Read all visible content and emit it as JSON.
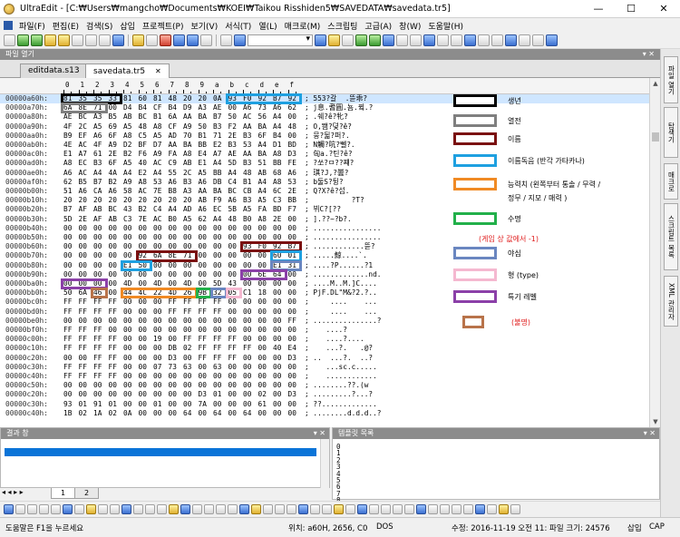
{
  "window": {
    "title": "UltraEdit - [C:₩Users₩mangcho₩Documents₩KOEI₩Taikou Risshiden5₩SAVEDATA₩savedata.tr5]",
    "minimize": "—",
    "maximize": "☐",
    "close": "✕"
  },
  "menu": [
    "파일(F)",
    "편집(E)",
    "검색(S)",
    "삽입",
    "프로젝트(P)",
    "보기(V)",
    "서식(T)",
    "열(L)",
    "매크로(M)",
    "스크립팅",
    "고급(A)",
    "창(W)",
    "도움말(H)"
  ],
  "file_panel": {
    "title": "파일 열기",
    "pin": "▾ ✕"
  },
  "tabs": [
    {
      "label": "editdata.s13",
      "active": false
    },
    {
      "label": "savedata.tr5",
      "active": true,
      "close": "✕"
    }
  ],
  "ruler": [
    "0",
    "1",
    "2",
    "3",
    "4",
    "5",
    "6",
    "7",
    "8",
    "9",
    "a",
    "b",
    "c",
    "d",
    "e",
    "f"
  ],
  "hex_rows": [
    {
      "addr": "00000a60h:",
      "bytes": [
        "81",
        "35",
        "35",
        "33",
        "81",
        "60",
        "81",
        "48",
        "20",
        "20",
        "0A",
        "93",
        "F0",
        "92",
        "B7",
        "92"
      ],
      "ascii": "; 553?갈  .뜯乖?",
      "current": true
    },
    {
      "addr": "00000a70h:",
      "bytes": [
        "6A",
        "8E",
        "71",
        "00",
        "D4",
        "B4",
        "CF",
        "B4",
        "D9",
        "A3",
        "AE",
        "00",
        "A6",
        "73",
        "A6",
        "62"
      ],
      "ascii": "; j息.耆圓.뇸.뀤.?"
    },
    {
      "addr": "00000a80h:",
      "bytes": [
        "AE",
        "BC",
        "A3",
        "B5",
        "AB",
        "BC",
        "B1",
        "6A",
        "AA",
        "BA",
        "B7",
        "50",
        "AC",
        "56",
        "A4",
        "00"
      ],
      "ascii": "; .쉐?ê?牝?"
    },
    {
      "addr": "00000a90h:",
      "bytes": [
        "4F",
        "2C",
        "A5",
        "69",
        "A5",
        "48",
        "A8",
        "CF",
        "A9",
        "50",
        "B3",
        "F2",
        "AA",
        "BA",
        "A4",
        "48"
      ],
      "ascii": "; O,뙘?뎢?ê?"
    },
    {
      "addr": "00000aa0h:",
      "bytes": [
        "B9",
        "EF",
        "A6",
        "6F",
        "A8",
        "C5",
        "A5",
        "AD",
        "70",
        "B1",
        "71",
        "2E",
        "B3",
        "6F",
        "B4",
        "00"
      ],
      "ascii": "; 뭉?뒮?퍼?."
    },
    {
      "addr": "00000ab0h:",
      "bytes": [
        "4E",
        "AC",
        "4F",
        "A9",
        "D2",
        "BF",
        "D7",
        "AA",
        "BA",
        "BB",
        "E2",
        "B3",
        "53",
        "A4",
        "D1",
        "BD"
      ],
      "ascii": "; N觸?吭?뻴?."
    },
    {
      "addr": "00000ac0h:",
      "bytes": [
        "E1",
        "A7",
        "61",
        "2E",
        "B2",
        "F6",
        "A9",
        "FA",
        "A8",
        "E4",
        "A7",
        "AE",
        "AA",
        "BA",
        "A8",
        "D3"
      ],
      "ascii": "; 匈a.?틴?ê?"
    },
    {
      "addr": "00000ad0h:",
      "bytes": [
        "A8",
        "EC",
        "B3",
        "6F",
        "A5",
        "40",
        "AC",
        "C9",
        "AB",
        "E1",
        "A4",
        "5D",
        "B3",
        "51",
        "BB",
        "FE"
      ],
      "ascii": "; ?쏘?ㅁ??쨰?"
    },
    {
      "addr": "00000ae0h:",
      "bytes": [
        "A6",
        "AC",
        "A4",
        "4A",
        "A4",
        "E2",
        "A4",
        "55",
        "2C",
        "A5",
        "BB",
        "A4",
        "48",
        "AB",
        "68",
        "A6"
      ],
      "ascii": "; 琪?J,?曇?"
    },
    {
      "addr": "00000af0h:",
      "bytes": [
        "62",
        "B5",
        "B7",
        "B2",
        "A9",
        "A8",
        "53",
        "A6",
        "B3",
        "A6",
        "DB",
        "C4",
        "B1",
        "A4",
        "A8",
        "53"
      ],
      "ascii": "; b둘S?뒹?"
    },
    {
      "addr": "00000b00h:",
      "bytes": [
        "51",
        "A6",
        "CA",
        "A6",
        "58",
        "AC",
        "7E",
        "B8",
        "A3",
        "AA",
        "BA",
        "BC",
        "CB",
        "A4",
        "6C",
        "2E"
      ],
      "ascii": "; Q?X?ê?섭."
    },
    {
      "addr": "00000b10h:",
      "bytes": [
        "20",
        "20",
        "20",
        "20",
        "20",
        "20",
        "20",
        "20",
        "20",
        "AB",
        "F9",
        "A6",
        "B3",
        "A5",
        "C3",
        "BB"
      ],
      "ascii": ";          ?T?"
    },
    {
      "addr": "00000b20h:",
      "bytes": [
        "B7",
        "AF",
        "AB",
        "BC",
        "43",
        "B2",
        "C4",
        "A4",
        "AD",
        "A6",
        "EC",
        "5B",
        "A5",
        "FA",
        "BD",
        "F7"
      ],
      "ascii": "; 뷔C?[??"
    },
    {
      "addr": "00000b30h:",
      "bytes": [
        "5D",
        "2E",
        "AF",
        "AB",
        "C3",
        "7E",
        "AC",
        "B0",
        "A5",
        "62",
        "A4",
        "48",
        "B0",
        "A8",
        "2E",
        "00"
      ],
      "ascii": "; ].??~?b?."
    },
    {
      "addr": "00000b40h:",
      "bytes": [
        "00",
        "00",
        "00",
        "00",
        "00",
        "00",
        "00",
        "00",
        "00",
        "00",
        "00",
        "00",
        "00",
        "00",
        "00",
        "00"
      ],
      "ascii": "; ................"
    },
    {
      "addr": "00000b50h:",
      "bytes": [
        "00",
        "00",
        "00",
        "00",
        "00",
        "00",
        "00",
        "00",
        "00",
        "00",
        "00",
        "00",
        "00",
        "00",
        "00",
        "00"
      ],
      "ascii": "; ................"
    },
    {
      "addr": "00000b60h:",
      "bytes": [
        "00",
        "00",
        "00",
        "00",
        "00",
        "00",
        "00",
        "00",
        "00",
        "00",
        "00",
        "00",
        "93",
        "F0",
        "92",
        "B7"
      ],
      "ascii": "; ............뜯?"
    },
    {
      "addr": "00000b70h:",
      "bytes": [
        "00",
        "00",
        "00",
        "00",
        "00",
        "92",
        "6A",
        "8E",
        "71",
        "00",
        "00",
        "00",
        "00",
        "00",
        "60",
        "01"
      ],
      "ascii": "; .....鯨....`."
    },
    {
      "addr": "00000b80h:",
      "bytes": [
        "00",
        "00",
        "00",
        "00",
        "E1",
        "50",
        "00",
        "00",
        "00",
        "00",
        "00",
        "00",
        "00",
        "00",
        "E1",
        "31"
      ],
      "ascii": "; ....?P......?1"
    },
    {
      "addr": "00000b90h:",
      "bytes": [
        "00",
        "00",
        "00",
        "00",
        "00",
        "00",
        "00",
        "00",
        "00",
        "00",
        "00",
        "00",
        "00",
        "6E",
        "64",
        "00"
      ],
      "ascii": "; .............nd."
    },
    {
      "addr": "00000ba0h:",
      "bytes": [
        "00",
        "00",
        "00",
        "00",
        "4D",
        "00",
        "4D",
        "00",
        "4D",
        "00",
        "5D",
        "43",
        "00",
        "00",
        "00",
        "00"
      ],
      "ascii": "; ....M..M.]C...."
    },
    {
      "addr": "00000bb0h:",
      "bytes": [
        "50",
        "6A",
        "46",
        "00",
        "44",
        "4C",
        "22",
        "4D",
        "26",
        "9B",
        "32",
        "05",
        "C1",
        "18",
        "00",
        "00"
      ],
      "ascii": "; PjF.DL\"M&?2.?.."
    },
    {
      "addr": "00000bc0h:",
      "bytes": [
        "FF",
        "FF",
        "FF",
        "FF",
        "00",
        "00",
        "00",
        "FF",
        "FF",
        "FF",
        "FF",
        "00",
        "00",
        "00",
        "00",
        "00"
      ],
      "ascii": ";     ....    ..."
    },
    {
      "addr": "00000bd0h:",
      "bytes": [
        "FF",
        "FF",
        "FF",
        "FF",
        "00",
        "00",
        "00",
        "FF",
        "FF",
        "FF",
        "FF",
        "00",
        "00",
        "00",
        "00",
        "00"
      ],
      "ascii": ";     ....    ..."
    },
    {
      "addr": "00000be0h:",
      "bytes": [
        "00",
        "00",
        "00",
        "00",
        "00",
        "00",
        "00",
        "00",
        "00",
        "00",
        "00",
        "00",
        "00",
        "00",
        "00",
        "FF"
      ],
      "ascii": "; ...............?"
    },
    {
      "addr": "00000bf0h:",
      "bytes": [
        "FF",
        "FF",
        "FF",
        "00",
        "00",
        "00",
        "00",
        "00",
        "00",
        "00",
        "00",
        "00",
        "00",
        "00",
        "00",
        "00"
      ],
      "ascii": ";    ....?"
    },
    {
      "addr": "00000c00h:",
      "bytes": [
        "FF",
        "FF",
        "FF",
        "FF",
        "00",
        "00",
        "19",
        "00",
        "FF",
        "FF",
        "FF",
        "FF",
        "00",
        "00",
        "00",
        "00"
      ],
      "ascii": ";    ....?...."
    },
    {
      "addr": "00000c10h:",
      "bytes": [
        "FF",
        "FF",
        "FF",
        "FF",
        "00",
        "00",
        "00",
        "DB",
        "02",
        "FF",
        "FF",
        "FF",
        "FF",
        "00",
        "40",
        "E4"
      ],
      "ascii": ";    ...?.   .@?"
    },
    {
      "addr": "00000c20h:",
      "bytes": [
        "00",
        "00",
        "FF",
        "FF",
        "00",
        "00",
        "00",
        "D3",
        "00",
        "FF",
        "FF",
        "FF",
        "00",
        "00",
        "00",
        "D3"
      ],
      "ascii": "; ..  ...?.  ..?"
    },
    {
      "addr": "00000c30h:",
      "bytes": [
        "FF",
        "FF",
        "FF",
        "FF",
        "00",
        "00",
        "07",
        "73",
        "63",
        "00",
        "63",
        "00",
        "00",
        "00",
        "00",
        "00"
      ],
      "ascii": ";    ...sc.c....."
    },
    {
      "addr": "00000c40h:",
      "bytes": [
        "FF",
        "FF",
        "FF",
        "FF",
        "00",
        "00",
        "00",
        "00",
        "00",
        "00",
        "00",
        "00",
        "00",
        "00",
        "00",
        "00"
      ],
      "ascii": ";    ............"
    },
    {
      "addr": "00000c50h:",
      "bytes": [
        "00",
        "00",
        "00",
        "00",
        "00",
        "00",
        "00",
        "00",
        "00",
        "00",
        "00",
        "00",
        "00",
        "00",
        "00",
        "00"
      ],
      "ascii": "; ........??.(w"
    },
    {
      "addr": "00000c20h:",
      "bytes": [
        "00",
        "00",
        "00",
        "00",
        "00",
        "00",
        "00",
        "00",
        "00",
        "D3",
        "01",
        "00",
        "00",
        "02",
        "00",
        "D3"
      ],
      "ascii": "; .........?...?"
    },
    {
      "addr": "00000c30h:",
      "bytes": [
        "93",
        "01",
        "91",
        "01",
        "00",
        "00",
        "01",
        "00",
        "00",
        "7A",
        "00",
        "00",
        "00",
        "61",
        "00",
        "00"
      ],
      "ascii": "; ??............."
    },
    {
      "addr": "00000c40h:",
      "bytes": [
        "1B",
        "02",
        "1A",
        "02",
        "0A",
        "00",
        "00",
        "00",
        "64",
        "00",
        "64",
        "00",
        "64",
        "00",
        "00",
        "00"
      ],
      "ascii": "; ........d.d.d..?"
    }
  ],
  "legend": [
    {
      "label": "생년",
      "color": "#000000"
    },
    {
      "label": "열전",
      "color": "#7f7f7f"
    },
    {
      "label": "이름",
      "color": "#7a1010"
    },
    {
      "label": "이름독음 (반각 가타카나)",
      "color": "#1ea0e0"
    },
    {
      "label": "능력치 (왼쪽부터 통솔 / 무력 /",
      "label2": "정무 / 지모 / 매력 )",
      "color": "#f08a24"
    },
    {
      "label": "수명",
      "color": "#22b04a"
    },
    {
      "label": "(게임 상 값에서 -1)",
      "color": "#e02020",
      "note": true
    },
    {
      "label": "야심",
      "color": "#6a86c0"
    },
    {
      "label": "형 (type)",
      "color": "#f5b8d0"
    },
    {
      "label": "특기 레벨",
      "color": "#8b40a8"
    },
    {
      "label": "(불명)",
      "color": "#b8734a",
      "note_red": true
    }
  ],
  "right_rail": [
    "파일 열기",
    "탐색기",
    "매크로",
    "스크립트 목록",
    "XML 관리자"
  ],
  "results_pane": {
    "title": "결과 창",
    "controls": "▾ ✕",
    "lines": [
      "1",
      "2",
      "3"
    ]
  },
  "bookmarks_pane": {
    "title": "템플릿 목록",
    "controls": "▾ ✕",
    "lines": [
      "0",
      "1",
      "2",
      "3",
      "4",
      "5",
      "6",
      "7",
      "8"
    ]
  },
  "bottom_tabs": [
    "1",
    "2"
  ],
  "status": {
    "help": "도움말은 F1을 누르세요",
    "position": "위치: a60H, 2656, C0",
    "format": "DOS",
    "modified": "수정: 2016-11-19 오전 11: 파일 크기: 24576",
    "insert": "삽입",
    "caps": "CAP"
  },
  "colors": {
    "selection": "#cfe6ff",
    "results_selection": "#0a74d8"
  }
}
